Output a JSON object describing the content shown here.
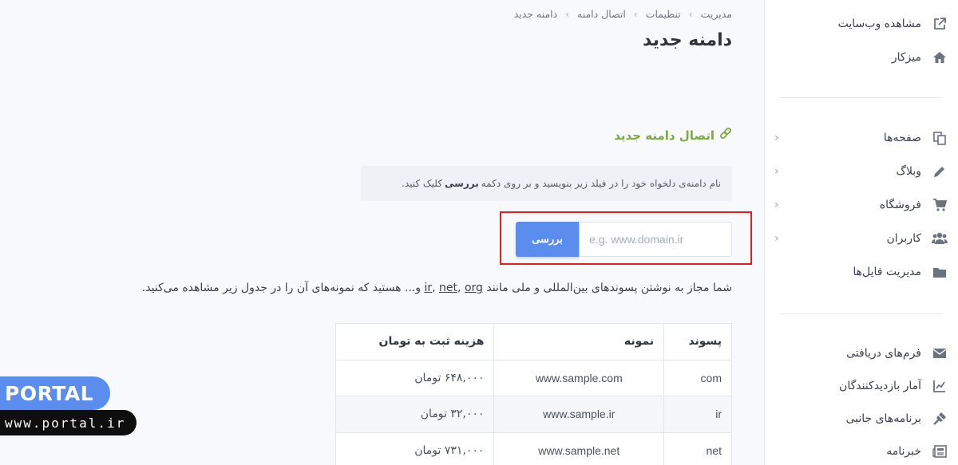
{
  "sidebar": {
    "items": [
      {
        "label": "مشاهده وب‌سایت",
        "icon": "external-link-icon"
      },
      {
        "label": "میزکار",
        "icon": "home-icon"
      },
      {
        "label": "صفحه‌ها",
        "icon": "copy-icon",
        "chevron": "‹"
      },
      {
        "label": "وبلاگ",
        "icon": "pencil-icon",
        "chevron": "‹"
      },
      {
        "label": "فروشگاه",
        "icon": "cart-icon",
        "chevron": "‹"
      },
      {
        "label": "کاربران",
        "icon": "users-icon",
        "chevron": "‹"
      },
      {
        "label": "مدیریت فایل‌ها",
        "icon": "folder-icon"
      },
      {
        "label": "فرم‌های دریافتی",
        "icon": "envelope-icon"
      },
      {
        "label": "آمار بازدیدکنندگان",
        "icon": "chart-icon"
      },
      {
        "label": "برنامه‌های جانبی",
        "icon": "plug-icon"
      },
      {
        "label": "خبرنامه",
        "icon": "newspaper-icon"
      }
    ]
  },
  "breadcrumb": [
    "مدیریت",
    "تنظیمات",
    "اتصال دامنه",
    "دامنه جدید"
  ],
  "breadcrumb_sep": "›",
  "page_title": "دامنه جدید",
  "section_title": "اتصال دامنه جدید",
  "info": {
    "text_before": "نام دامنه‌ی دلخواه خود را در فیلد زیر بنویسید و بر روی دکمه",
    "bold": "بررسی",
    "text_after": "کلیک کنید."
  },
  "domain_input": {
    "placeholder": "e.g. www.domain.ir",
    "value": ""
  },
  "check_button": "بررسی",
  "description": {
    "before": "شما مجاز به نوشتن پسوندهای بین‌المللی و ملی مانند",
    "tlds": [
      "ir",
      "net",
      "org"
    ],
    "after": "و... هستید که نمونه‌های آن را در جدول زیر مشاهده می‌کنید."
  },
  "table": {
    "headers": [
      "پسوند",
      "نمونه",
      "هزینه ثبت به تومان"
    ],
    "rows": [
      [
        "com",
        "www.sample.com",
        "۶۴۸,۰۰۰ تومان"
      ],
      [
        "ir",
        "www.sample.ir",
        "۳۲,۰۰۰ تومان"
      ],
      [
        "net",
        "www.sample.net",
        "۷۳۱,۰۰۰ تومان"
      ]
    ]
  },
  "watermark": {
    "brand": "PORTAL",
    "url": "www.portal.ir"
  },
  "colors": {
    "accent_blue": "#5b8def",
    "section_green": "#7bab3c",
    "highlight_red": "#e0201b"
  }
}
